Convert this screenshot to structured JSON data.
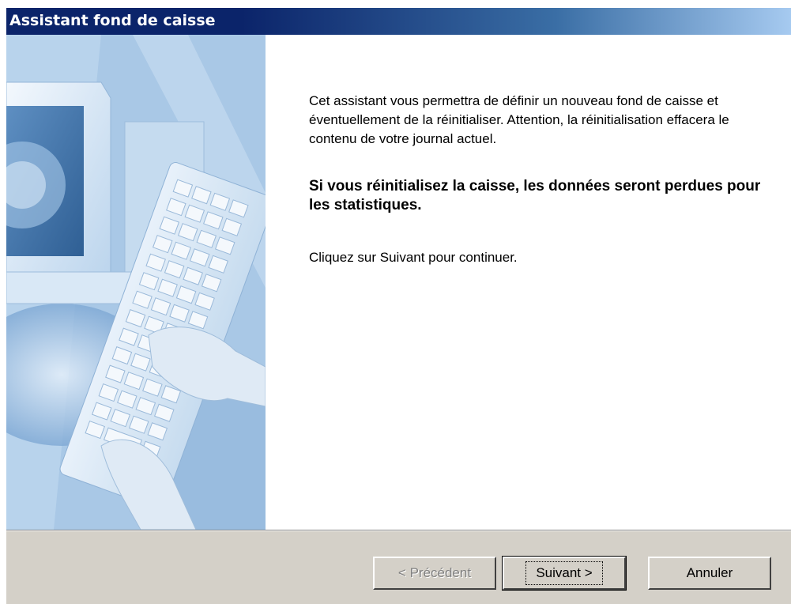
{
  "window": {
    "title": "Assistant fond de caisse"
  },
  "content": {
    "intro": "Cet assistant vous permettra de définir un nouveau fond de caisse et éventuellement de la réinitialiser. Attention, la réinitialisation effacera le contenu de votre journal actuel.",
    "warning": "Si vous réinitialisez la caisse, les données seront perdues pour les statistiques.",
    "instruction": "Cliquez sur Suivant pour continuer."
  },
  "buttons": {
    "previous": {
      "label": "< Précédent",
      "enabled": false
    },
    "next": {
      "label": "Suivant >",
      "enabled": true
    },
    "cancel": {
      "label": "Annuler",
      "enabled": true
    }
  },
  "colors": {
    "title_bar_start": "#0b246a",
    "title_bar_end": "#a6caf0",
    "dialog_face": "#d4d0c8"
  },
  "illustration": {
    "icon": "computer-keyboard-hands-illustration"
  }
}
